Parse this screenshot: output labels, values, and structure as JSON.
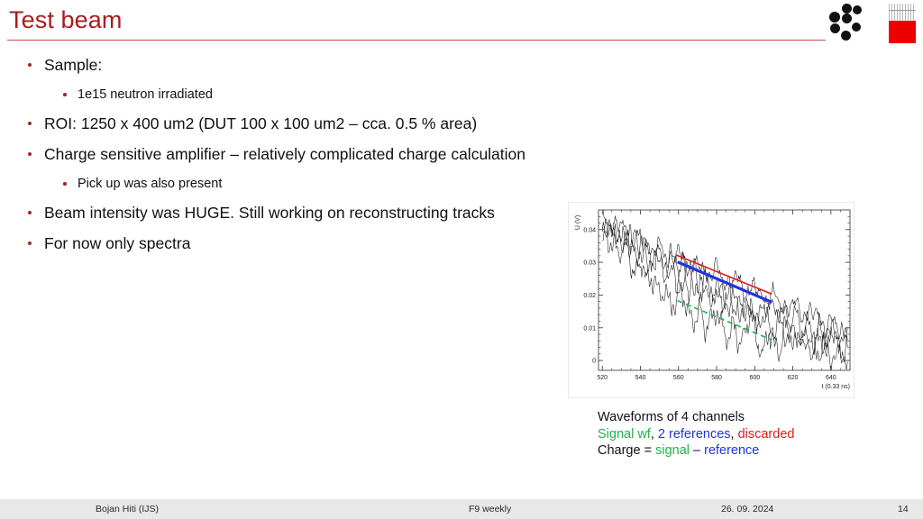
{
  "slide": {
    "title": "Test beam",
    "accent_color": "#A81D1D",
    "rule_color": "#C0504D"
  },
  "logos": {
    "jsi": {
      "name": "jozef-stefan-institute-logo",
      "dot_color": "#111111"
    },
    "atlas": {
      "name": "atlas-experiment-logo",
      "bar_color": "#EE0000"
    }
  },
  "bullets": [
    {
      "level": 1,
      "text": "Sample:"
    },
    {
      "level": 2,
      "text": "1e15 neutron irradiated"
    },
    {
      "level": 1,
      "text": "ROI: 1250 x 400 um2 (DUT 100 x 100 um2 – cca. 0.5 % area)"
    },
    {
      "level": 1,
      "text": "Charge sensitive amplifier – relatively complicated charge calculation"
    },
    {
      "level": 2,
      "text": "Pick up was also present"
    },
    {
      "level": 1,
      "text": "Beam intensity was HUGE. Still working on reconstructing tracks"
    },
    {
      "level": 1,
      "text": "For now only spectra"
    }
  ],
  "caption": {
    "line1": "Waveforms of 4 channels",
    "line2_signal": "Signal wf",
    "line2_sep1": ", ",
    "line2_references": "2 references",
    "line2_sep2": ", ",
    "line2_discarded": "discarded",
    "line3_prefix": "Charge = ",
    "line3_signal": "signal",
    "line3_minus": " – ",
    "line3_reference": "reference",
    "colors": {
      "signal": "#22B14C",
      "reference": "#2233DD",
      "discarded": "#E01B1B"
    }
  },
  "footer": {
    "author": "Bojan Hiti (IJS)",
    "event": "F9 weekly",
    "date": "26. 09. 2024",
    "page": "14"
  },
  "chart_data": {
    "type": "line",
    "title": "",
    "xlabel": "t (0.33 ns)",
    "ylabel": "U (V)",
    "xlim": [
      518,
      650
    ],
    "ylim": [
      -0.003,
      0.046
    ],
    "xticks": [
      520,
      540,
      560,
      580,
      600,
      620,
      640
    ],
    "yticks": [
      0,
      0.01,
      0.02,
      0.03,
      0.04
    ],
    "ytick_labels": [
      "0",
      "0.01",
      "0.02",
      "0.03",
      "0.04"
    ],
    "grid": false,
    "legend": "none",
    "series": [
      {
        "name": "waveform channel 1 (signal)",
        "color": "#1a1a1a",
        "style": "solid",
        "x": [
          520,
          523,
          526,
          529,
          532,
          535,
          538,
          541,
          544,
          547,
          550,
          553,
          556,
          559,
          562,
          565,
          568,
          571,
          574,
          577,
          580,
          583,
          586,
          589,
          592,
          595,
          598,
          601,
          604,
          607,
          610,
          613,
          616,
          619,
          622,
          625,
          628,
          631,
          634,
          637,
          640,
          643,
          646,
          649
        ],
        "y": [
          0.0445,
          0.0415,
          0.0432,
          0.0392,
          0.0408,
          0.0372,
          0.0388,
          0.035,
          0.0366,
          0.0332,
          0.0348,
          0.0318,
          0.0334,
          0.0302,
          0.032,
          0.0288,
          0.0306,
          0.0272,
          0.029,
          0.0258,
          0.0276,
          0.0244,
          0.0262,
          0.0228,
          0.0248,
          0.0212,
          0.0234,
          0.0196,
          0.0218,
          0.018,
          0.0202,
          0.0166,
          0.0188,
          0.015,
          0.0172,
          0.0136,
          0.0158,
          0.012,
          0.0142,
          0.0106,
          0.0128,
          0.009,
          0.0114,
          0.0078
        ]
      },
      {
        "name": "waveform channel 2 (reference)",
        "color": "#1a1a1a",
        "style": "solid",
        "x": [
          520,
          523,
          526,
          529,
          532,
          535,
          538,
          541,
          544,
          547,
          550,
          553,
          556,
          559,
          562,
          565,
          568,
          571,
          574,
          577,
          580,
          583,
          586,
          589,
          592,
          595,
          598,
          601,
          604,
          607,
          610,
          613,
          616,
          619,
          622,
          625,
          628,
          631,
          634,
          637,
          640,
          643,
          646,
          649
        ],
        "y": [
          0.039,
          0.042,
          0.0368,
          0.0402,
          0.0345,
          0.0382,
          0.0322,
          0.036,
          0.03,
          0.034,
          0.0278,
          0.0318,
          0.0256,
          0.0296,
          0.0236,
          0.0276,
          0.0216,
          0.0256,
          0.0196,
          0.0234,
          0.0178,
          0.0214,
          0.0158,
          0.0196,
          0.014,
          0.0176,
          0.0122,
          0.0158,
          0.0104,
          0.0138,
          0.0086,
          0.012,
          0.0068,
          0.0102,
          0.0052,
          0.0086,
          0.0036,
          0.0068,
          0.002,
          0.0052,
          0.0006,
          0.0038,
          -0.0008,
          0.0024
        ]
      },
      {
        "name": "waveform channel 3 (reference)",
        "color": "#1a1a1a",
        "style": "solid",
        "x": [
          520,
          523,
          526,
          529,
          532,
          535,
          538,
          541,
          544,
          547,
          550,
          553,
          556,
          559,
          562,
          565,
          568,
          571,
          574,
          577,
          580,
          583,
          586,
          589,
          592,
          595,
          598,
          601,
          604,
          607,
          610,
          613,
          616,
          619,
          622,
          625,
          628,
          631,
          634,
          637,
          640,
          643,
          646,
          649
        ],
        "y": [
          0.0425,
          0.038,
          0.0412,
          0.0352,
          0.0396,
          0.0328,
          0.038,
          0.0302,
          0.0362,
          0.028,
          0.0346,
          0.0256,
          0.0328,
          0.0234,
          0.0312,
          0.021,
          0.0294,
          0.0188,
          0.0278,
          0.0164,
          0.026,
          0.0142,
          0.0244,
          0.0118,
          0.0226,
          0.0096,
          0.021,
          0.0074,
          0.0192,
          0.0152,
          0.0176,
          0.0128,
          0.0158,
          0.0104,
          0.0142,
          0.0082,
          0.0124,
          0.0058,
          0.0108,
          0.0034,
          0.009,
          0.007,
          0.0074,
          0.0046
        ]
      },
      {
        "name": "waveform channel 4 (discarded)",
        "color": "#1a1a1a",
        "style": "solid",
        "x": [
          520,
          523,
          526,
          529,
          532,
          535,
          538,
          541,
          544,
          547,
          550,
          553,
          556,
          559,
          562,
          565,
          568,
          571,
          574,
          577,
          580,
          583,
          586,
          589,
          592,
          595,
          598,
          601,
          604,
          607,
          610,
          613,
          616,
          619,
          622,
          625,
          628,
          631,
          634,
          637,
          640,
          643,
          646,
          649
        ],
        "y": [
          0.04,
          0.0362,
          0.0358,
          0.033,
          0.0372,
          0.029,
          0.0262,
          0.03,
          0.0228,
          0.025,
          0.0196,
          0.0218,
          0.0162,
          0.0188,
          0.0208,
          0.015,
          0.0118,
          0.016,
          0.009,
          0.0132,
          0.0152,
          0.01,
          0.0062,
          0.0118,
          0.0038,
          0.009,
          0.0135,
          0.006,
          0.0015,
          0.009,
          0.0052,
          0.0022,
          0.0112,
          0.007,
          0.003,
          0.009,
          0.005,
          0.0018,
          0.0078,
          0.004,
          0.01,
          0.006,
          0.0022,
          0.0058
        ]
      }
    ],
    "fits": [
      {
        "name": "red-fit-discarded",
        "color": "#E01B1B",
        "style": "solid",
        "x": [
          558.5,
          609
        ],
        "y": [
          0.0323,
          0.0203
        ],
        "linewidth": 1.6
      },
      {
        "name": "blue-fit-reference",
        "color": "#2233DD",
        "style": "solid",
        "x": [
          559.5,
          609
        ],
        "y": [
          0.0301,
          0.0178
        ],
        "linewidth": 3.2
      },
      {
        "name": "green-fit-signal",
        "color": "#22B14C",
        "style": "dashed",
        "x": [
          559.5,
          609
        ],
        "y": [
          0.0183,
          0.0063
        ],
        "linewidth": 1.6
      }
    ]
  }
}
